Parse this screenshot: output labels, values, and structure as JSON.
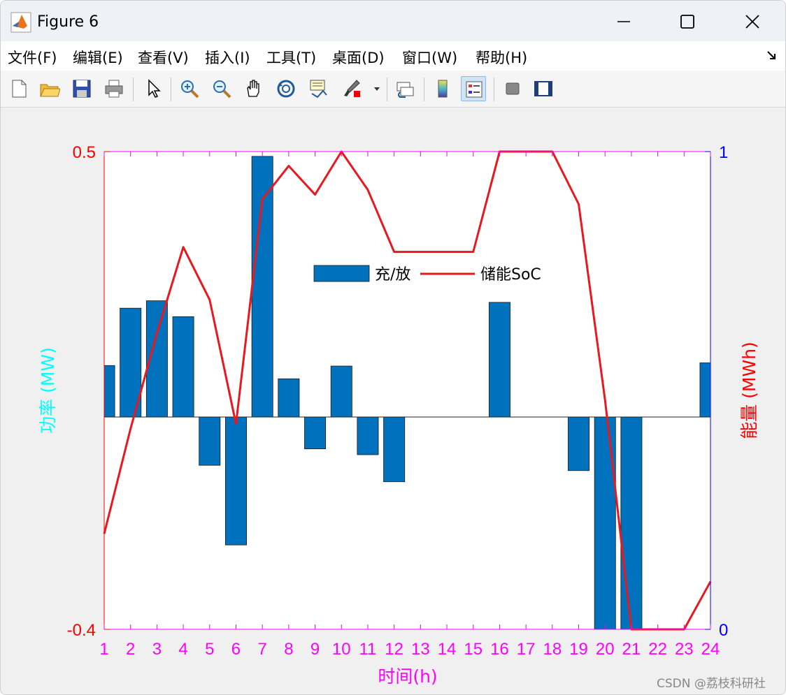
{
  "window": {
    "title": "Figure 6",
    "minimize_glyph": "—",
    "maximize_glyph": "☐",
    "close_glyph": "✕"
  },
  "menu": {
    "items": [
      "文件(F)",
      "编辑(E)",
      "查看(V)",
      "插入(I)",
      "工具(T)",
      "桌面(D)",
      "窗口(W)",
      "帮助(H)"
    ]
  },
  "toolbar": {
    "icons": [
      "new-figure-icon",
      "open-file-icon",
      "save-icon",
      "print-icon",
      "pointer-icon",
      "zoom-in-icon",
      "zoom-out-icon",
      "pan-icon",
      "rotate-3d-icon",
      "data-cursor-icon",
      "brush-icon",
      "link-plot-icon",
      "colorbar-icon",
      "legend-icon",
      "hide-plot-tools-icon",
      "show-plot-tools-icon"
    ]
  },
  "colors": {
    "bar": "#0072BD",
    "line": "#E8181E",
    "left_axis": "#FF0000",
    "right_axis": "#0000FF",
    "x_ticks": "#FF00FF",
    "ylabel_left": "#00FFFF",
    "ylabel_right": "#FF0000",
    "xlabel": "#FF00FF",
    "axes_frame_top": "#FF00FF",
    "axes_frame_right": "#0000FF",
    "axes_frame_left": "#FF0000"
  },
  "chart_data": {
    "type": "bar",
    "x": [
      1,
      2,
      3,
      4,
      5,
      6,
      7,
      8,
      9,
      10,
      11,
      12,
      13,
      14,
      15,
      16,
      17,
      18,
      19,
      20,
      21,
      22,
      23,
      24
    ],
    "xlabel": "时间(h)",
    "ylabel_left": "功率 (MW)",
    "ylabel_right": "能量 (MWh)",
    "ylim_left": [
      -0.4,
      0.5
    ],
    "ylim_right": [
      0,
      1
    ],
    "yticks_left": [
      "-0.4",
      "0.5"
    ],
    "yticks_right": [
      "0",
      "1"
    ],
    "legend_position": "inside-upper-center",
    "series": [
      {
        "name": "充/放",
        "type": "bar",
        "axis": "left",
        "values": [
          0.097,
          0.205,
          0.219,
          0.189,
          -0.091,
          -0.241,
          0.491,
          0.072,
          -0.06,
          0.096,
          -0.071,
          -0.122,
          0,
          0,
          0,
          0.216,
          0,
          0,
          -0.101,
          -0.4,
          -0.4,
          0,
          0,
          0.102
        ]
      },
      {
        "name": "储能SoC",
        "type": "line",
        "axis": "right",
        "values": [
          0.2,
          0.42,
          0.62,
          0.8,
          0.69,
          0.43,
          0.9,
          0.97,
          0.91,
          1.0,
          0.92,
          0.79,
          0.79,
          0.79,
          0.79,
          1.0,
          1.0,
          1.0,
          0.89,
          0.48,
          0.0,
          0.0,
          0.0,
          0.1
        ]
      }
    ]
  },
  "watermark": "CSDN @荔枝科研社"
}
